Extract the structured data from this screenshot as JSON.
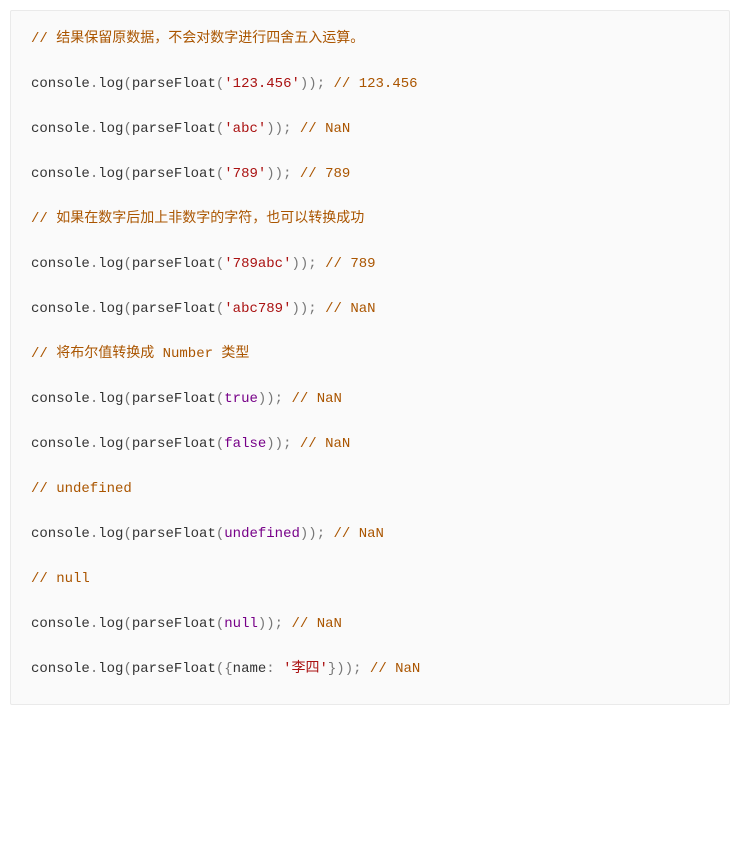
{
  "lines": [
    [
      {
        "cls": "tok-comment",
        "text": "// 结果保留原数据，不会对数字进行四舍五入运算。"
      }
    ],
    [
      {
        "cls": "tok-ident",
        "text": "console"
      },
      {
        "cls": "tok-punct",
        "text": "."
      },
      {
        "cls": "tok-ident",
        "text": "log"
      },
      {
        "cls": "tok-punct",
        "text": "("
      },
      {
        "cls": "tok-ident",
        "text": "parseFloat"
      },
      {
        "cls": "tok-punct",
        "text": "("
      },
      {
        "cls": "tok-string",
        "text": "'123.456'"
      },
      {
        "cls": "tok-punct",
        "text": "));"
      },
      {
        "cls": "tok-ident",
        "text": " "
      },
      {
        "cls": "tok-comment",
        "text": "// 123.456"
      }
    ],
    [
      {
        "cls": "tok-ident",
        "text": "console"
      },
      {
        "cls": "tok-punct",
        "text": "."
      },
      {
        "cls": "tok-ident",
        "text": "log"
      },
      {
        "cls": "tok-punct",
        "text": "("
      },
      {
        "cls": "tok-ident",
        "text": "parseFloat"
      },
      {
        "cls": "tok-punct",
        "text": "("
      },
      {
        "cls": "tok-string",
        "text": "'abc'"
      },
      {
        "cls": "tok-punct",
        "text": "));"
      },
      {
        "cls": "tok-ident",
        "text": " "
      },
      {
        "cls": "tok-comment",
        "text": "// NaN"
      }
    ],
    [
      {
        "cls": "tok-ident",
        "text": "console"
      },
      {
        "cls": "tok-punct",
        "text": "."
      },
      {
        "cls": "tok-ident",
        "text": "log"
      },
      {
        "cls": "tok-punct",
        "text": "("
      },
      {
        "cls": "tok-ident",
        "text": "parseFloat"
      },
      {
        "cls": "tok-punct",
        "text": "("
      },
      {
        "cls": "tok-string",
        "text": "'789'"
      },
      {
        "cls": "tok-punct",
        "text": "));"
      },
      {
        "cls": "tok-ident",
        "text": " "
      },
      {
        "cls": "tok-comment",
        "text": "// 789"
      }
    ],
    [
      {
        "cls": "tok-comment",
        "text": "// 如果在数字后加上非数字的字符，也可以转换成功"
      }
    ],
    [
      {
        "cls": "tok-ident",
        "text": "console"
      },
      {
        "cls": "tok-punct",
        "text": "."
      },
      {
        "cls": "tok-ident",
        "text": "log"
      },
      {
        "cls": "tok-punct",
        "text": "("
      },
      {
        "cls": "tok-ident",
        "text": "parseFloat"
      },
      {
        "cls": "tok-punct",
        "text": "("
      },
      {
        "cls": "tok-string",
        "text": "'789abc'"
      },
      {
        "cls": "tok-punct",
        "text": "));"
      },
      {
        "cls": "tok-ident",
        "text": " "
      },
      {
        "cls": "tok-comment",
        "text": "// 789"
      }
    ],
    [
      {
        "cls": "tok-ident",
        "text": "console"
      },
      {
        "cls": "tok-punct",
        "text": "."
      },
      {
        "cls": "tok-ident",
        "text": "log"
      },
      {
        "cls": "tok-punct",
        "text": "("
      },
      {
        "cls": "tok-ident",
        "text": "parseFloat"
      },
      {
        "cls": "tok-punct",
        "text": "("
      },
      {
        "cls": "tok-string",
        "text": "'abc789'"
      },
      {
        "cls": "tok-punct",
        "text": "));"
      },
      {
        "cls": "tok-ident",
        "text": " "
      },
      {
        "cls": "tok-comment",
        "text": "// NaN"
      }
    ],
    [
      {
        "cls": "tok-comment",
        "text": "// 将布尔值转换成 Number 类型"
      }
    ],
    [
      {
        "cls": "tok-ident",
        "text": "console"
      },
      {
        "cls": "tok-punct",
        "text": "."
      },
      {
        "cls": "tok-ident",
        "text": "log"
      },
      {
        "cls": "tok-punct",
        "text": "("
      },
      {
        "cls": "tok-ident",
        "text": "parseFloat"
      },
      {
        "cls": "tok-punct",
        "text": "("
      },
      {
        "cls": "tok-keyword",
        "text": "true"
      },
      {
        "cls": "tok-punct",
        "text": "));"
      },
      {
        "cls": "tok-ident",
        "text": " "
      },
      {
        "cls": "tok-comment",
        "text": "// NaN"
      }
    ],
    [
      {
        "cls": "tok-ident",
        "text": "console"
      },
      {
        "cls": "tok-punct",
        "text": "."
      },
      {
        "cls": "tok-ident",
        "text": "log"
      },
      {
        "cls": "tok-punct",
        "text": "("
      },
      {
        "cls": "tok-ident",
        "text": "parseFloat"
      },
      {
        "cls": "tok-punct",
        "text": "("
      },
      {
        "cls": "tok-keyword",
        "text": "false"
      },
      {
        "cls": "tok-punct",
        "text": "));"
      },
      {
        "cls": "tok-ident",
        "text": " "
      },
      {
        "cls": "tok-comment",
        "text": "// NaN"
      }
    ],
    [
      {
        "cls": "tok-comment",
        "text": "// undefined"
      }
    ],
    [
      {
        "cls": "tok-ident",
        "text": "console"
      },
      {
        "cls": "tok-punct",
        "text": "."
      },
      {
        "cls": "tok-ident",
        "text": "log"
      },
      {
        "cls": "tok-punct",
        "text": "("
      },
      {
        "cls": "tok-ident",
        "text": "parseFloat"
      },
      {
        "cls": "tok-punct",
        "text": "("
      },
      {
        "cls": "tok-keyword",
        "text": "undefined"
      },
      {
        "cls": "tok-punct",
        "text": "));"
      },
      {
        "cls": "tok-ident",
        "text": " "
      },
      {
        "cls": "tok-comment",
        "text": "// NaN"
      }
    ],
    [
      {
        "cls": "tok-comment",
        "text": "// null"
      }
    ],
    [
      {
        "cls": "tok-ident",
        "text": "console"
      },
      {
        "cls": "tok-punct",
        "text": "."
      },
      {
        "cls": "tok-ident",
        "text": "log"
      },
      {
        "cls": "tok-punct",
        "text": "("
      },
      {
        "cls": "tok-ident",
        "text": "parseFloat"
      },
      {
        "cls": "tok-punct",
        "text": "("
      },
      {
        "cls": "tok-keyword",
        "text": "null"
      },
      {
        "cls": "tok-punct",
        "text": "));"
      },
      {
        "cls": "tok-ident",
        "text": " "
      },
      {
        "cls": "tok-comment",
        "text": "// NaN"
      }
    ],
    [
      {
        "cls": "tok-ident",
        "text": "console"
      },
      {
        "cls": "tok-punct",
        "text": "."
      },
      {
        "cls": "tok-ident",
        "text": "log"
      },
      {
        "cls": "tok-punct",
        "text": "("
      },
      {
        "cls": "tok-ident",
        "text": "parseFloat"
      },
      {
        "cls": "tok-punct",
        "text": "({"
      },
      {
        "cls": "tok-ident",
        "text": "name"
      },
      {
        "cls": "tok-punct",
        "text": ": "
      },
      {
        "cls": "tok-string",
        "text": "'李四'"
      },
      {
        "cls": "tok-punct",
        "text": "}));"
      },
      {
        "cls": "tok-ident",
        "text": " "
      },
      {
        "cls": "tok-comment",
        "text": "// NaN"
      }
    ]
  ]
}
